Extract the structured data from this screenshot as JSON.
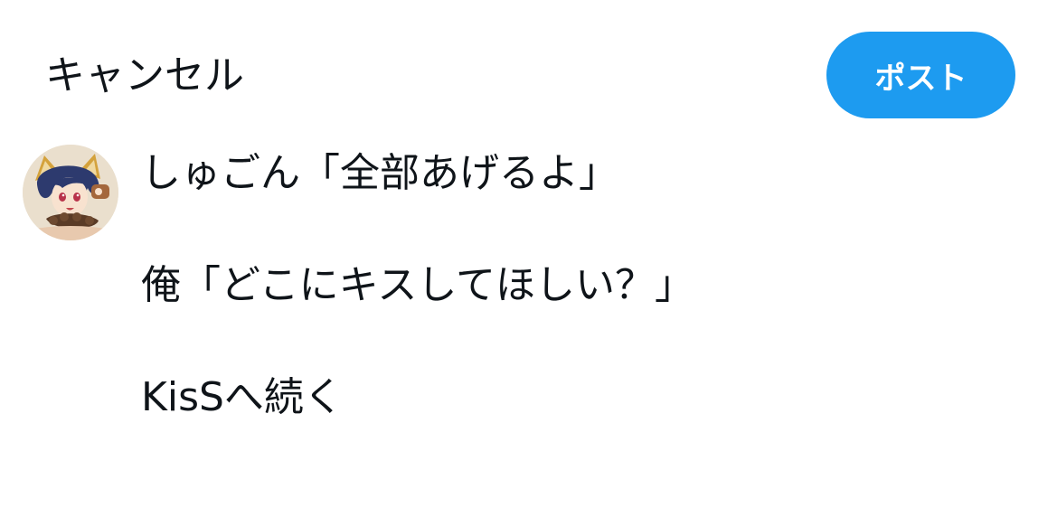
{
  "header": {
    "cancel_label": "キャンセル",
    "post_label": "ポスト"
  },
  "composer": {
    "lines": [
      "しゅごん「全部あげるよ」",
      "俺「どこにキスしてほしい？」",
      "KisSへ続く"
    ]
  },
  "colors": {
    "accent": "#1d9bf0",
    "text": "#0f1419",
    "background": "#ffffff"
  }
}
